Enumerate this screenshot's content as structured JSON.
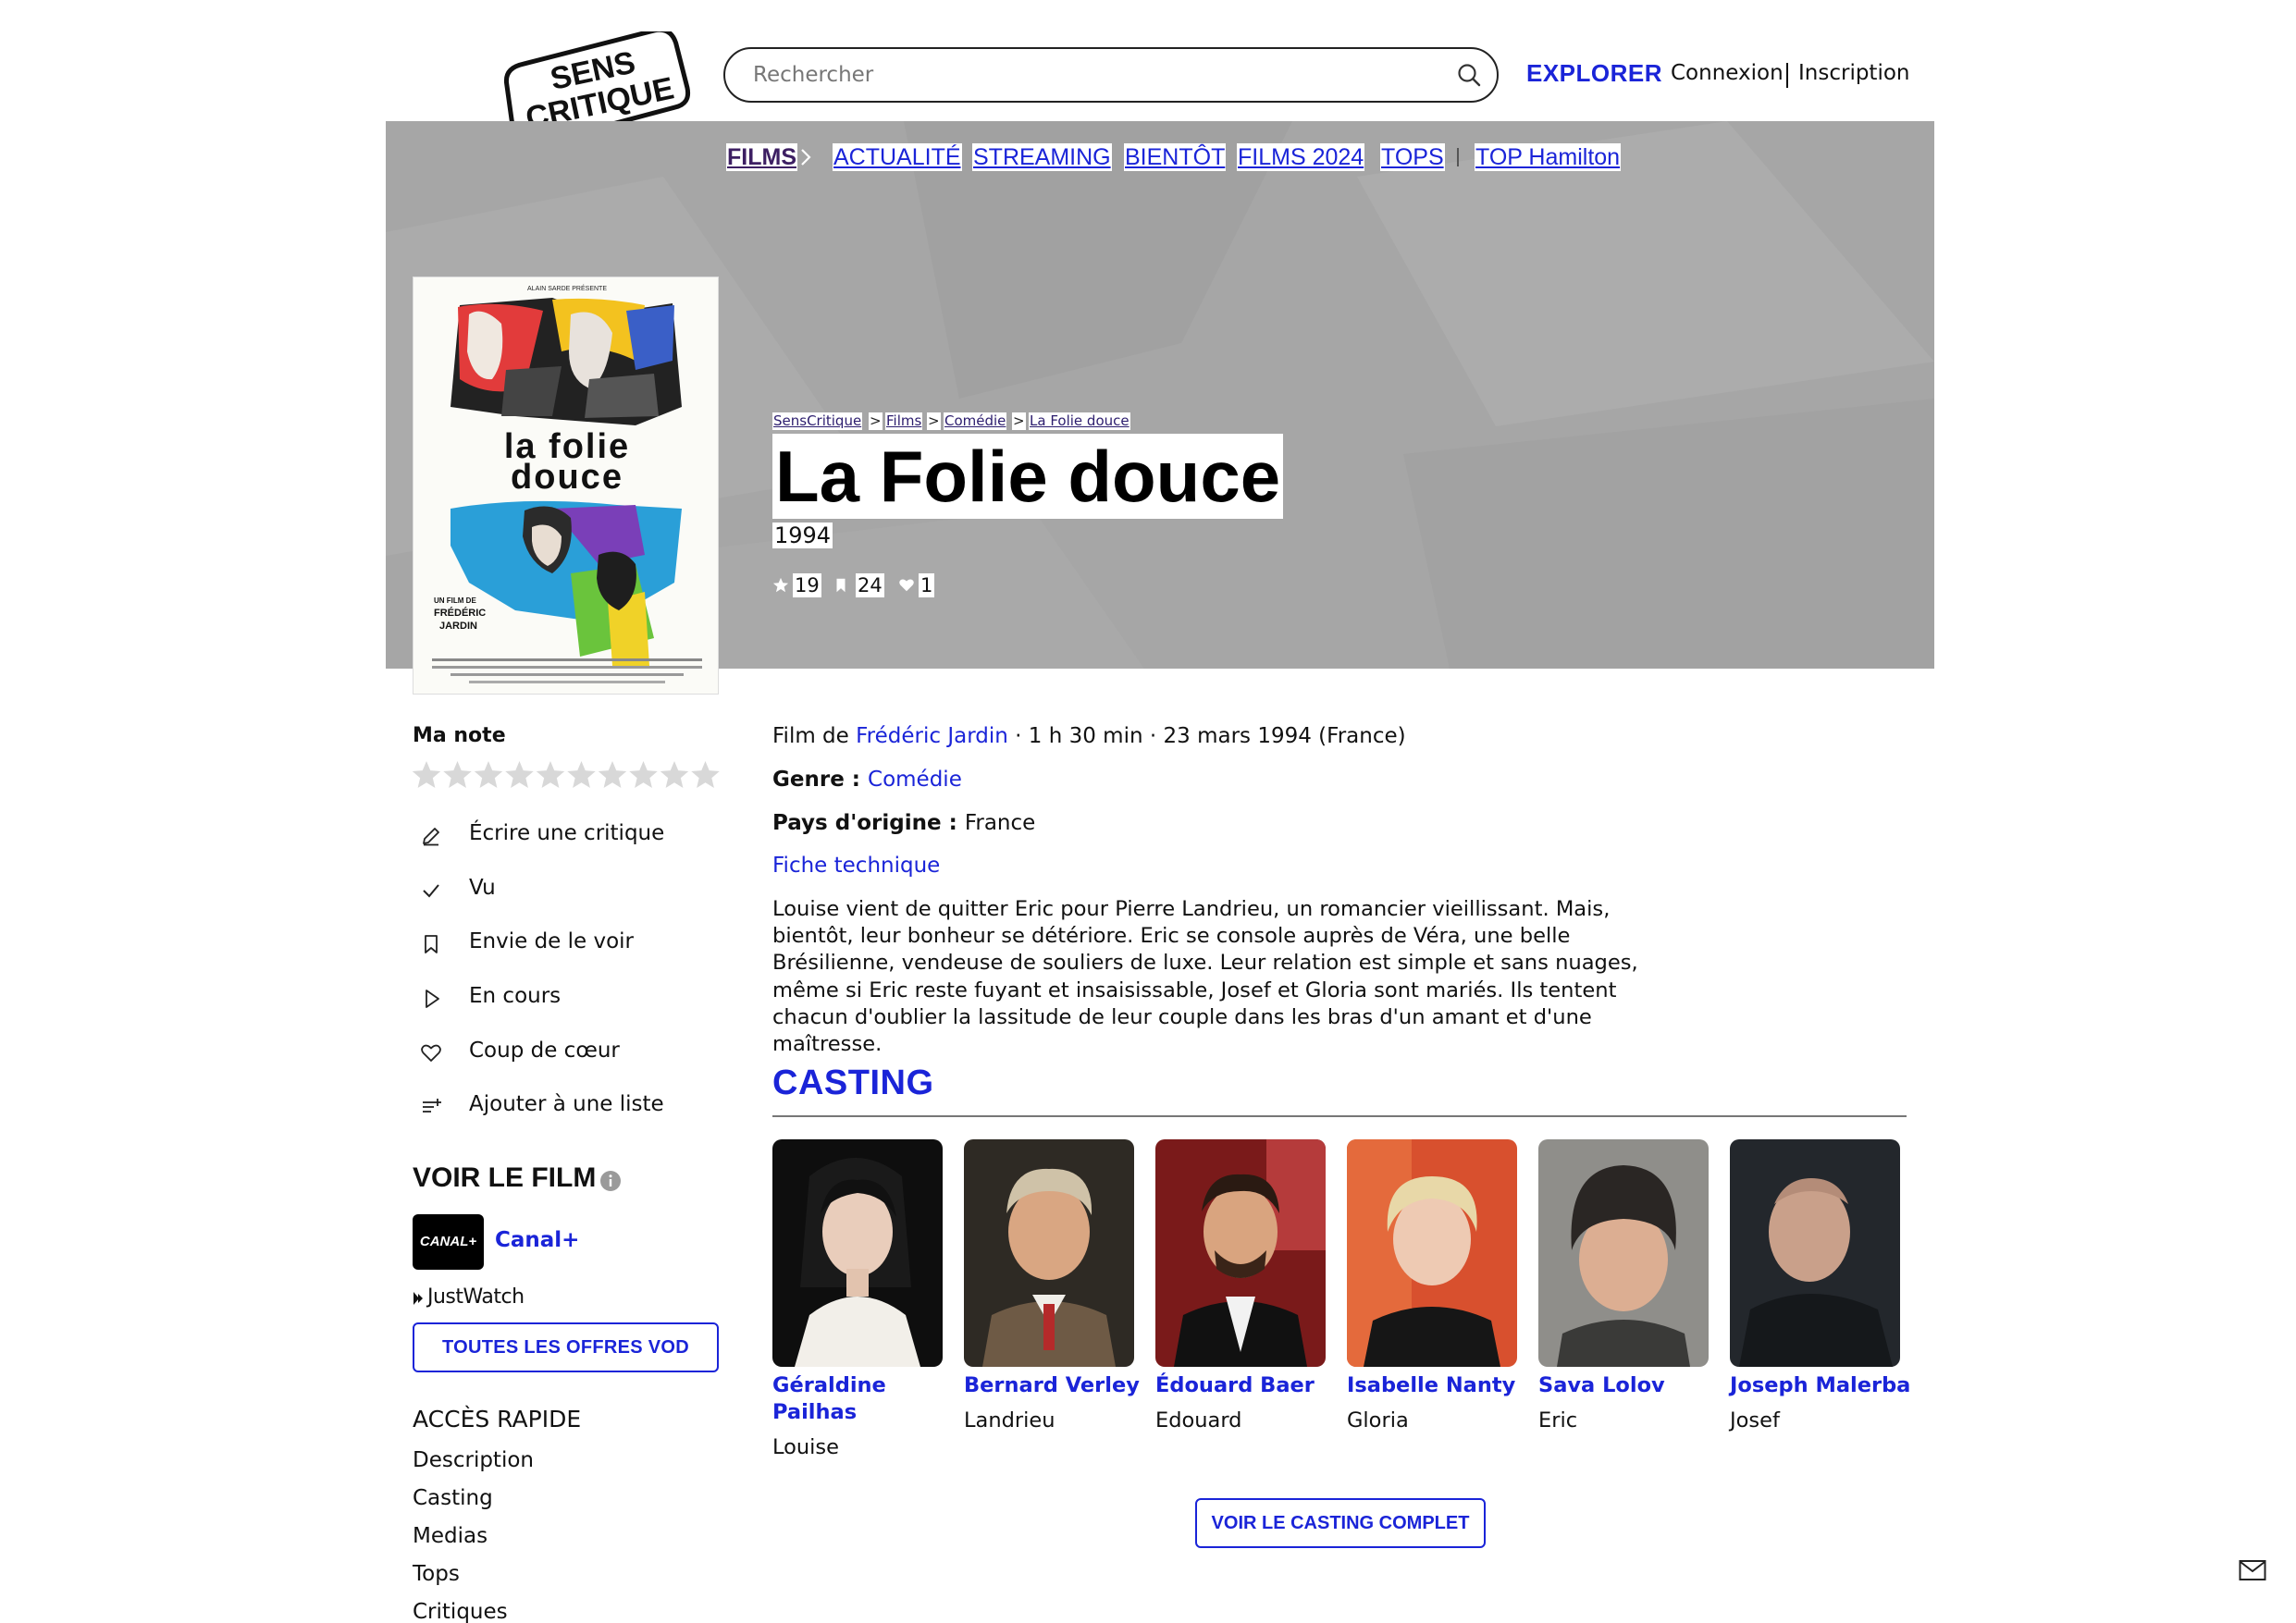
{
  "header": {
    "logo_text_top": "SENS",
    "logo_text_bottom": "CRITIQUE",
    "search_placeholder": "Rechercher",
    "explore_label": "EXPLORER",
    "login_label": "Connexion",
    "signup_label": "Inscription"
  },
  "nav": {
    "films": "FILMS",
    "actualite": "ACTUALITÉ",
    "streaming": "STREAMING",
    "bientot": "BIENTÔT",
    "films2024": "FILMS 2024",
    "tops": "TOPS",
    "top_hamilton": "TOP Hamilton"
  },
  "breadcrumb": [
    "SensCritique",
    "Films",
    "Comédie",
    "La Folie douce"
  ],
  "breadcrumb_separator": ">",
  "movie": {
    "title": "La Folie douce",
    "year": "1994",
    "ratings_count": "19",
    "wishlist_count": "24",
    "favorites_count": "1",
    "director_prefix": "Film de ",
    "director": "Frédéric Jardin",
    "meta_suffix": " · 1 h 30 min · 23 mars 1994 (France)",
    "genre_label": "Genre : ",
    "genre": "Comédie",
    "country_label": "Pays d'origine : ",
    "country": "France",
    "fiche_technique": "Fiche technique",
    "synopsis": "Louise vient de quitter Eric pour Pierre Landrieu, un romancier vieillissant. Mais, bientôt, leur bonheur se détériore. Eric se console auprès de Véra, une belle Brésilienne, vendeuse de souliers de luxe. Leur relation est simple et sans nuages, même si Eric reste fuyant et insaisissable, Josef et Gloria sont mariés. Ils tentent chacun d'oublier la lassitude de leur couple dans les bras d'un amant et d'une maîtresse."
  },
  "poster": {
    "presenter": "ALAIN SARDE PRÉSENTE",
    "title_line1": "la folie",
    "title_line2": "douce",
    "credit_line1": "UN FILM DE",
    "credit_line2": "FRÉDÉRIC",
    "credit_line3": "JARDIN"
  },
  "sidebar": {
    "my_rating_label": "Ma note",
    "rating_star_count": 10,
    "actions": [
      {
        "label": "Écrire une critique",
        "icon": "pencil-icon"
      },
      {
        "label": "Vu",
        "icon": "check-icon"
      },
      {
        "label": "Envie de le voir",
        "icon": "bookmark-icon"
      },
      {
        "label": "En cours",
        "icon": "play-icon"
      },
      {
        "label": "Coup de cœur",
        "icon": "heart-icon"
      },
      {
        "label": "Ajouter à une liste",
        "icon": "list-add-icon"
      }
    ],
    "watch_title": "VOIR LE FILM",
    "provider_logo": "CANAL+",
    "provider_name": "Canal+",
    "justwatch": "JustWatch",
    "vod_button": "TOUTES LES OFFRES VOD",
    "quick_access_title": "ACCÈS RAPIDE",
    "quick_links": [
      "Description",
      "Casting",
      "Medias",
      "Tops",
      "Critiques"
    ]
  },
  "casting": {
    "title": "CASTING",
    "actors": [
      {
        "name": "Géraldine Pailhas",
        "role": "Louise"
      },
      {
        "name": "Bernard Verley",
        "role": "Landrieu"
      },
      {
        "name": "Édouard Baer",
        "role": "Edouard"
      },
      {
        "name": "Isabelle Nanty",
        "role": "Gloria"
      },
      {
        "name": "Sava Lolov",
        "role": "Eric"
      },
      {
        "name": "Joseph Malerba",
        "role": "Josef"
      }
    ],
    "full_cast_button": "VOIR LE CASTING COMPLET"
  },
  "colors": {
    "accent": "#1a24d8",
    "nav_active": "#3d1f63",
    "hero_background": "#a6a6a6"
  }
}
